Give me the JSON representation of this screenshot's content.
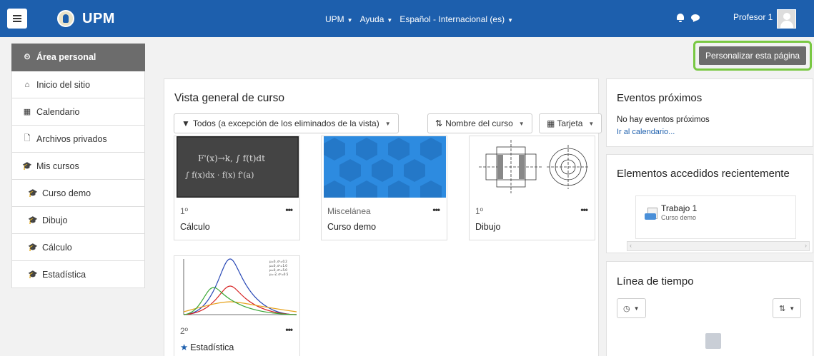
{
  "navbar": {
    "brand": "UPM",
    "menu_items": [
      {
        "label": "UPM"
      },
      {
        "label": "Ayuda"
      },
      {
        "label": "Español - Internacional (es)"
      }
    ],
    "user_name": "Profesor 1",
    "colors": {
      "bar": "#1d5fad"
    }
  },
  "sidebar": {
    "items": [
      {
        "label": "Área personal",
        "icon": "dashboard-icon",
        "glyph": "⏲",
        "active": true
      },
      {
        "label": "Inicio del sitio",
        "icon": "home-icon",
        "glyph": "⌂"
      },
      {
        "label": "Calendario",
        "icon": "calendar-icon",
        "glyph": "▦"
      },
      {
        "label": "Archivos privados",
        "icon": "file-icon",
        "glyph": "🗋"
      },
      {
        "label": "Mis cursos",
        "icon": "graduation-cap-icon",
        "glyph": "🎓"
      },
      {
        "label": "Curso demo",
        "icon": "graduation-cap-icon",
        "glyph": "🎓",
        "sub": true
      },
      {
        "label": "Dibujo",
        "icon": "graduation-cap-icon",
        "glyph": "🎓",
        "sub": true
      },
      {
        "label": "Cálculo",
        "icon": "graduation-cap-icon",
        "glyph": "🎓",
        "sub": true
      },
      {
        "label": "Estadística",
        "icon": "graduation-cap-icon",
        "glyph": "🎓",
        "sub": true
      }
    ]
  },
  "customize_button": "Personalizar esta página",
  "course_overview": {
    "title": "Vista general de curso",
    "filter": "Todos (a excepción de los eliminados de la vista)",
    "sort": "Nombre del curso",
    "view": "Tarjeta",
    "courses": [
      {
        "category": "1º",
        "name": "Cálculo",
        "image": "chalkboard-formulas",
        "starred": false
      },
      {
        "category": "Miscelánea",
        "name": "Curso demo",
        "image": "blue-pattern",
        "starred": false
      },
      {
        "category": "1º",
        "name": "Dibujo",
        "image": "technical-drawing",
        "starred": false
      },
      {
        "category": "2º",
        "name": "Estadística",
        "image": "gaussian-curves",
        "starred": true
      }
    ]
  },
  "upcoming_events": {
    "title": "Eventos próximos",
    "empty_text": "No hay eventos próximos",
    "link": "Ir al calendario..."
  },
  "recent_items": {
    "title": "Elementos accedidos recientemente",
    "items": [
      {
        "name": "Trabajo 1",
        "course": "Curso demo"
      }
    ]
  },
  "timeline": {
    "title": "Línea de tiempo"
  },
  "chalk_text": {
    "line1": "F'(x)→k, ∫ f(t)dt",
    "line2": "∫ f(x)dx · f(x) f'(a)"
  },
  "chart_legend": [
    "μ=0, σ²=0.2",
    "μ=0, σ²=1.0",
    "μ=0, σ²=5.0",
    "μ=-2, σ²=0.5"
  ]
}
